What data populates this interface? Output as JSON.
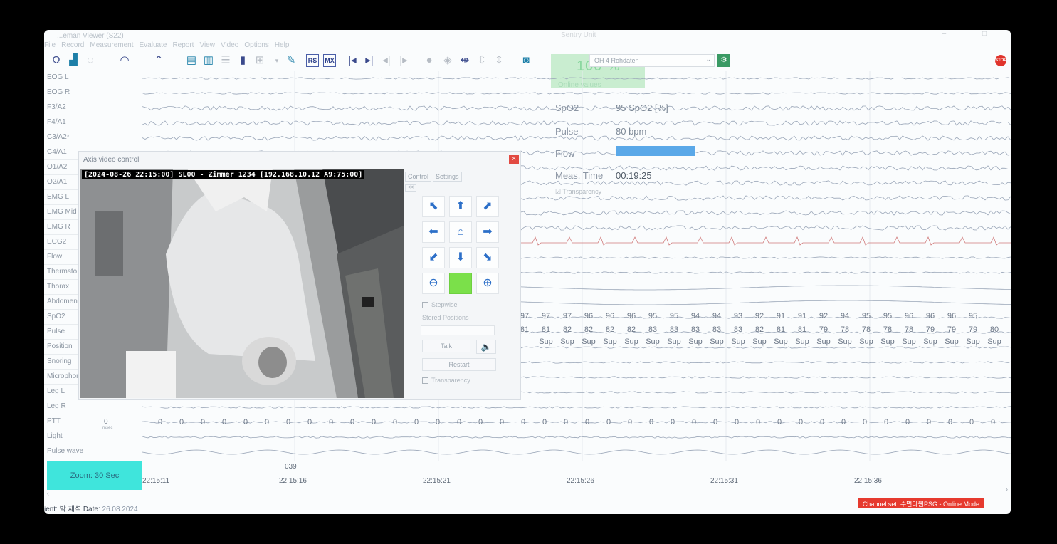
{
  "app": {
    "title": "...eman Viewer (S22)",
    "sentry_label": "Sentry Unit"
  },
  "menu": [
    "File",
    "Record",
    "Measurement",
    "Evaluate",
    "Report",
    "View",
    "Video",
    "Options",
    "Help"
  ],
  "toolbar": {
    "montage_combo": "OH 4 Rohdaten",
    "zoom_percent": "100 %",
    "online_values_label": "Online values",
    "stop_label": "STOP"
  },
  "channels": [
    "EOG L",
    "EOG R",
    "F3/A2",
    "F4/A1",
    "C3/A2*",
    "C4/A1",
    "O1/A2",
    "O2/A1",
    "EMG L",
    "EMG Mid",
    "EMG R",
    "ECG2",
    "Flow",
    "Thermsto",
    "Thorax",
    "Abdomen",
    "SpO2",
    "Pulse",
    "Position",
    "Snoring",
    "Microphon",
    "Leg L",
    "Leg R",
    "PTT",
    "Light",
    "Pulse wave"
  ],
  "channel_extra": {
    "ptt_value": "0",
    "ptt_unit": "msec"
  },
  "overlay": {
    "spo2_label": "SpO2",
    "spo2_value": "95 SpO2 [%]",
    "pulse_label": "Pulse",
    "pulse_value": "80 bpm",
    "flow_label": "Flow",
    "meas_time_label": "Meas. Time",
    "meas_time_value": "00:19:25",
    "transparency": "Transparency"
  },
  "spo2_values": [
    "97",
    "97",
    "97",
    "96",
    "96",
    "96",
    "95",
    "95",
    "94",
    "94",
    "93",
    "92",
    "91",
    "91",
    "92",
    "94",
    "95",
    "95",
    "96",
    "96",
    "96",
    "95"
  ],
  "pulse_values": [
    "81",
    "81",
    "82",
    "82",
    "82",
    "82",
    "83",
    "83",
    "83",
    "83",
    "83",
    "82",
    "81",
    "81",
    "79",
    "78",
    "78",
    "78",
    "78",
    "79",
    "79",
    "79",
    "80"
  ],
  "position_values": [
    "Sup",
    "Sup",
    "Sup",
    "Sup",
    "Sup",
    "Sup",
    "Sup",
    "Sup",
    "Sup",
    "Sup",
    "Sup",
    "Sup",
    "Sup",
    "Sup",
    "Sup",
    "Sup",
    "Sup",
    "Sup",
    "Sup",
    "Sup",
    "Sup",
    "Sup"
  ],
  "ptt_row": [
    "0",
    "0",
    "0",
    "0",
    "0",
    "0",
    "0",
    "0",
    "0",
    "0",
    "0",
    "0",
    "0",
    "0",
    "0",
    "0",
    "0",
    "0",
    "0",
    "0",
    "0",
    "0",
    "0",
    "0",
    "0",
    "0",
    "0",
    "0",
    "0",
    "0",
    "0",
    "0",
    "0",
    "0",
    "0",
    "0",
    "0",
    "0",
    "0",
    "0",
    "0"
  ],
  "time_axis": {
    "epoch": "039",
    "labels": [
      "22:15:11",
      "22:15:16",
      "22:15:21",
      "22:15:26",
      "22:15:31",
      "22:15:36"
    ]
  },
  "zoom_button": "Zoom: 30 Sec",
  "status": {
    "patient_prefix": "ient: 박 재석 Date:",
    "date": "26.08.2024",
    "channel_set": "Channel set: 수면다원PSG - Online Mode"
  },
  "video": {
    "title": "Axis video control",
    "caption": "[2024-08-26 22:15:00] SL00 - Zimmer 1234 [192.168.10.12 A9:75:00]",
    "tab_control": "Control",
    "tab_settings": "Settings",
    "small_btn": "<<",
    "stepwise": "Stepwise",
    "stored_positions": "Stored Positions",
    "talk": "Talk",
    "restart": "Restart",
    "transparency": "Transparency",
    "close": "×"
  }
}
